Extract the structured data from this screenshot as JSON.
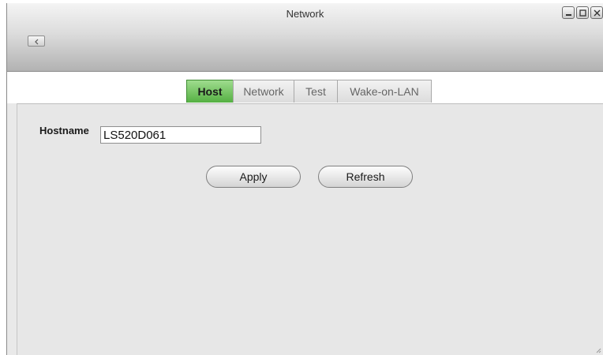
{
  "window": {
    "title": "Network",
    "controls": [
      "minimize-icon",
      "maximize-icon",
      "close-icon"
    ]
  },
  "toolbar": {
    "back_icon": "chevron-left-icon"
  },
  "tabs": [
    {
      "label": "Host",
      "active": true
    },
    {
      "label": "Network",
      "active": false
    },
    {
      "label": "Test",
      "active": false
    },
    {
      "label": "Wake-on-LAN",
      "active": false
    }
  ],
  "form": {
    "hostname_label": "Hostname",
    "hostname_value": "LS520D061"
  },
  "actions": {
    "apply_label": "Apply",
    "refresh_label": "Refresh"
  },
  "colors": {
    "active_tab": "#5fb84d",
    "titlebar": "#c8c8c8",
    "panel": "#e7e7e7"
  }
}
